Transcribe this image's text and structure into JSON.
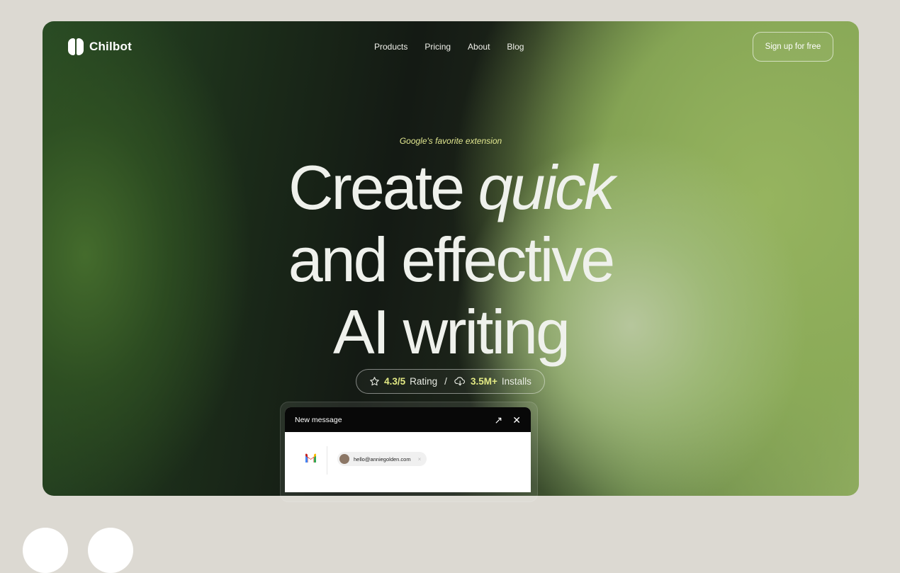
{
  "brand": {
    "name": "Chilbot"
  },
  "nav": {
    "items": [
      "Products",
      "Pricing",
      "About",
      "Blog"
    ]
  },
  "cta": {
    "signup_label": "Sign up for free"
  },
  "hero": {
    "tagline": "Google's favorite extension",
    "headline_line1_a": "Create",
    "headline_line1_b": "quick",
    "headline_line2": "and effective",
    "headline_line3": "AI writing"
  },
  "stats": {
    "rating_value": "4.3/5",
    "rating_label": "Rating",
    "separator": "/",
    "installs_value": "3.5M+",
    "installs_label": "Installs"
  },
  "compose": {
    "title": "New message",
    "recipient": "hello@anniegolden.com",
    "remove_label": "×",
    "expand_icon": "↗",
    "close_icon": "✕"
  },
  "icons": {
    "logo": "chilbot-logo",
    "star": "star-icon",
    "download": "cloud-download-icon",
    "gmail": "gmail-icon"
  },
  "colors": {
    "accent": "#e3ea84",
    "page_background": "#dcd9d2",
    "headline": "#eff1ec"
  }
}
